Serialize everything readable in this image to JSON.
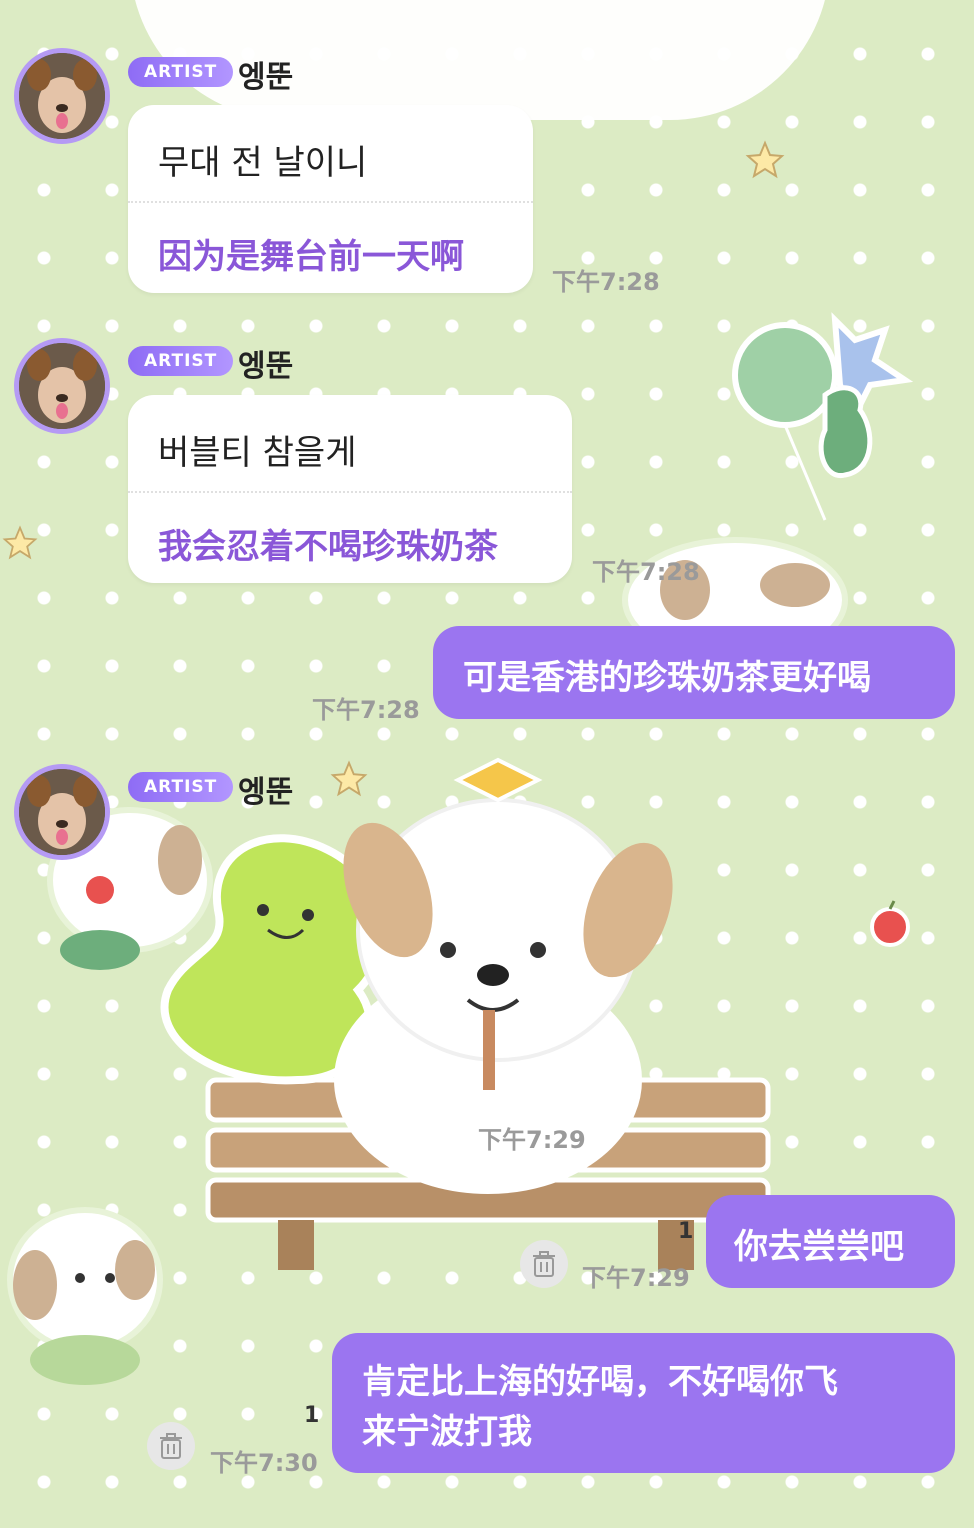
{
  "chat": {
    "messages": [
      {
        "badge": "ARTIST",
        "name": "엥뚠",
        "original": "무대 전 날이니",
        "translation": "因为是舞台前一天啊",
        "time": "下午7:28"
      },
      {
        "badge": "ARTIST",
        "name": "엥뚠",
        "original": "버블티 참을게",
        "translation": "我会忍着不喝珍珠奶茶",
        "time": "下午7:28"
      },
      {
        "text": "可是香港的珍珠奶茶更好喝",
        "time": "下午7:28"
      },
      {
        "badge": "ARTIST",
        "name": "엥뚠",
        "sticker": "puppy-dino-bench-sticker",
        "time": "下午7:29"
      },
      {
        "text": "你去尝尝吧",
        "time": "下午7:29",
        "unread": "1"
      },
      {
        "text_line1": "肯定比上海的好喝，不好喝你飞",
        "text_line2": "来宁波打我",
        "time": "下午7:30",
        "unread": "1"
      }
    ]
  },
  "colors": {
    "accent": "#9b75f0",
    "translation": "#8a57d8",
    "background": "#dcebc4"
  },
  "icons": {
    "delete": "trash-icon",
    "star": "star-icon"
  }
}
